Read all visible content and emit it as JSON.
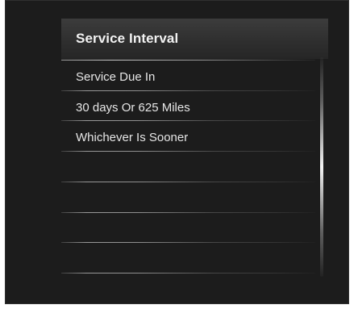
{
  "panel": {
    "title": "Service Interval",
    "rows": [
      "Service Due In",
      "30 days Or 625 Miles",
      "Whichever Is Sooner",
      "",
      "",
      "",
      ""
    ]
  },
  "colors": {
    "background": "#1c1c1c",
    "header": "#333333",
    "text": "#e6e6e6"
  }
}
